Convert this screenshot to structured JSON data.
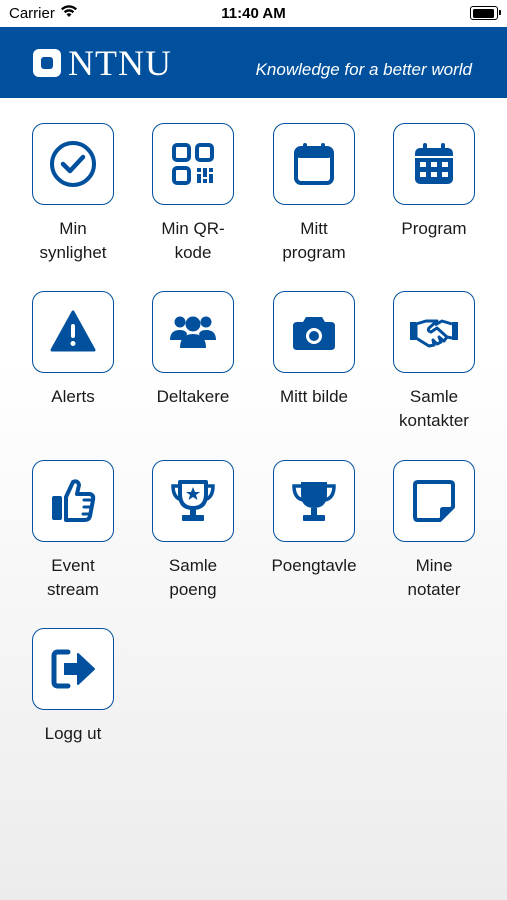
{
  "status_bar": {
    "carrier": "Carrier",
    "time": "11:40 AM"
  },
  "header": {
    "logo": "NTNU",
    "tagline": "Knowledge for a better world"
  },
  "accent_color": "#00509e",
  "tiles": [
    {
      "icon": "check-circle-icon",
      "label": "Min\nsynlighet"
    },
    {
      "icon": "qr-code-icon",
      "label": "Min QR-\nkode"
    },
    {
      "icon": "calendar-icon",
      "label": "Mitt\nprogram"
    },
    {
      "icon": "calendar-grid-icon",
      "label": "Program"
    },
    {
      "icon": "warning-icon",
      "label": "Alerts"
    },
    {
      "icon": "users-icon",
      "label": "Deltakere"
    },
    {
      "icon": "camera-icon",
      "label": "Mitt bilde"
    },
    {
      "icon": "handshake-icon",
      "label": "Samle\nkontakter"
    },
    {
      "icon": "thumbs-up-icon",
      "label": "Event\nstream"
    },
    {
      "icon": "star-trophy-icon",
      "label": "Samle\npoeng"
    },
    {
      "icon": "trophy-icon",
      "label": "Poengtavle"
    },
    {
      "icon": "sticky-note-icon",
      "label": "Mine\nnotater"
    },
    {
      "icon": "logout-icon",
      "label": "Logg ut"
    }
  ]
}
